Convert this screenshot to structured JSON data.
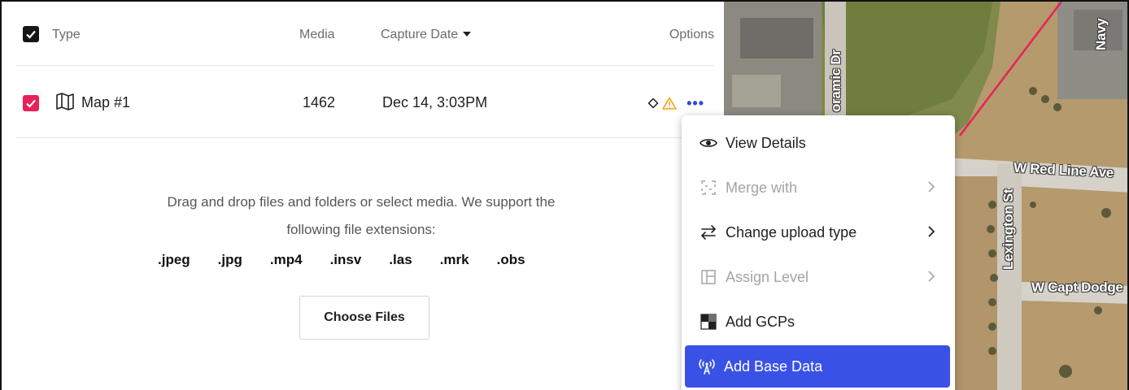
{
  "table": {
    "header": {
      "type_label": "Type",
      "media_label": "Media",
      "date_label": "Capture Date",
      "options_label": "Options"
    },
    "rows": [
      {
        "name": "Map #1",
        "media": "1462",
        "capture_date": "Dec 14, 3:03PM",
        "checked": true,
        "status_icons": [
          "circle-outline-icon",
          "warning-icon"
        ]
      }
    ]
  },
  "upload": {
    "message_line1": "Drag and drop files and folders or select media. We support the",
    "message_line2": "following file extensions:",
    "extensions": [
      ".jpeg",
      ".jpg",
      ".mp4",
      ".insv",
      ".las",
      ".mrk",
      ".obs"
    ],
    "choose_label": "Choose Files"
  },
  "menu": {
    "items": [
      {
        "label": "View Details",
        "icon": "eye-icon",
        "disabled": false,
        "submenu": false
      },
      {
        "label": "Merge with",
        "icon": "merge-icon",
        "disabled": true,
        "submenu": true
      },
      {
        "label": "Change upload type",
        "icon": "swap-arrows-icon",
        "disabled": false,
        "submenu": true
      },
      {
        "label": "Assign Level",
        "icon": "layout-icon",
        "disabled": true,
        "submenu": true
      },
      {
        "label": "Add GCPs",
        "icon": "checker-icon",
        "disabled": false,
        "submenu": false
      },
      {
        "label": "Add Base Data",
        "icon": "broadcast-tower-icon",
        "disabled": false,
        "submenu": false,
        "highlighted": true
      }
    ]
  },
  "map": {
    "labels": [
      "oramic Dr",
      "Navy",
      "W Red Line Ave",
      "Lexington St",
      "W Capt Dodge"
    ]
  },
  "colors": {
    "accent": "#3a51e6",
    "checkbox_checked": "#e8215a",
    "warning": "#f2a313",
    "boundary_line": "#e8215a"
  }
}
